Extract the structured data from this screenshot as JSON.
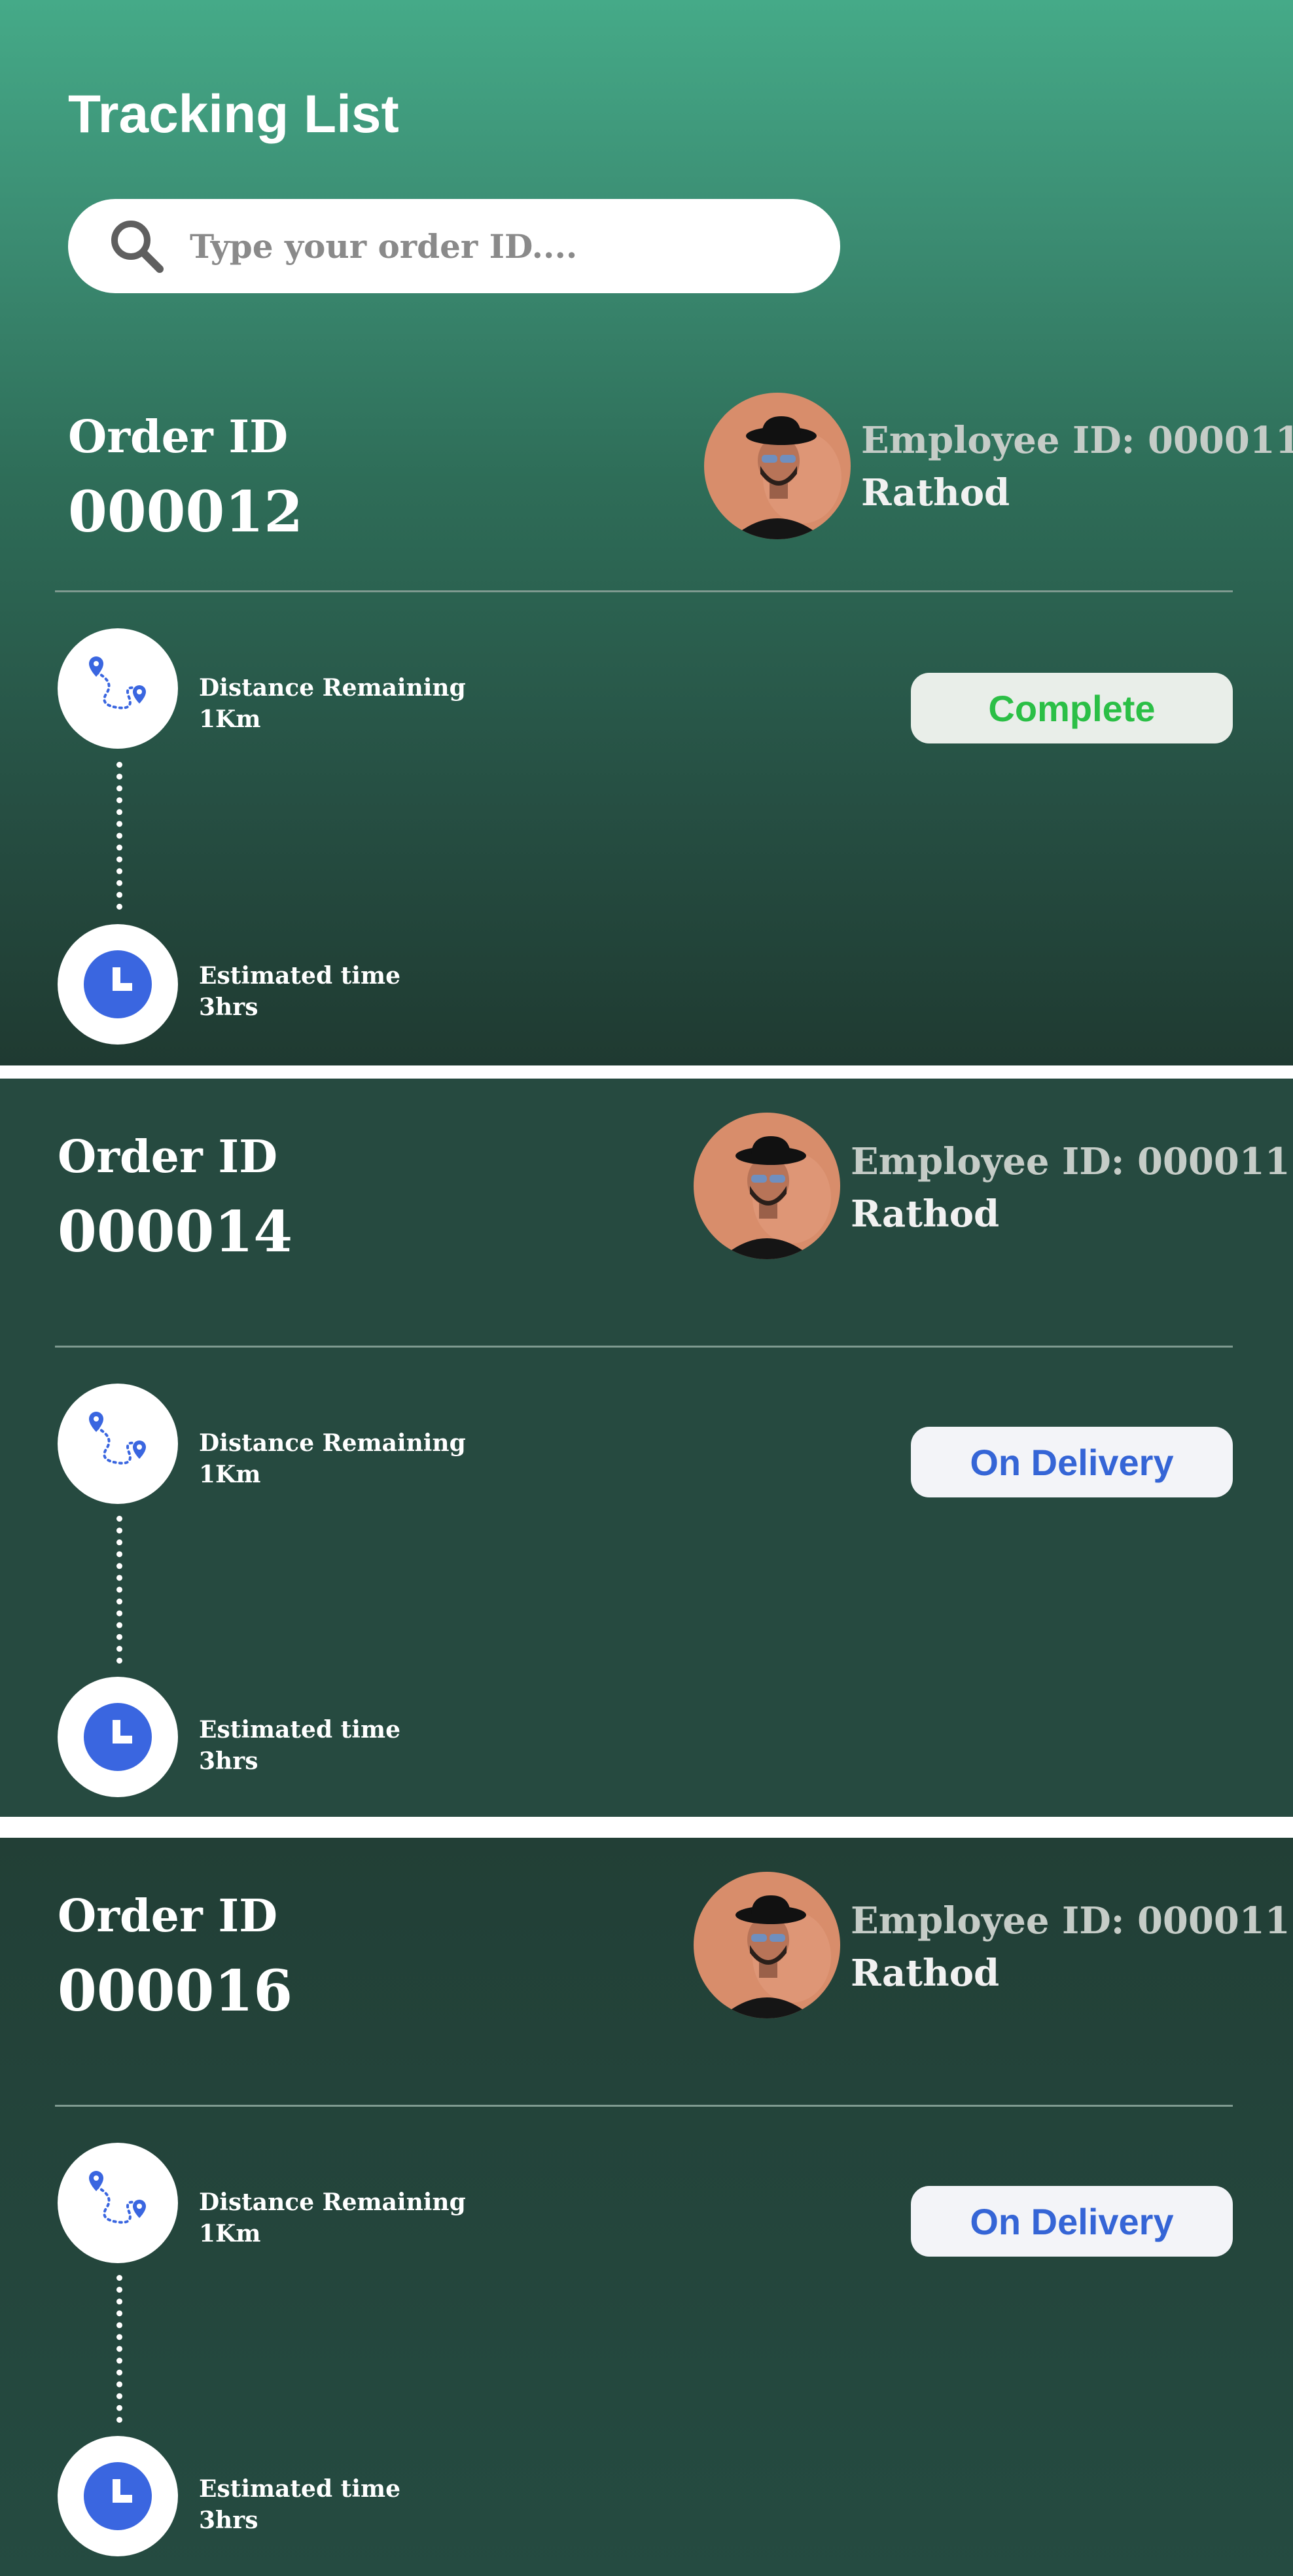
{
  "header": {
    "title": "Tracking List"
  },
  "search": {
    "placeholder": "Type your order ID...."
  },
  "orders": [
    {
      "label": "Order ID",
      "id": "000012",
      "employee_id": "Employee ID: 000011",
      "employee_name": "Rathod",
      "distance_label": "Distance Remaining",
      "distance_value": "1Km",
      "time_label": "Estimated time",
      "time_value": "3hrs",
      "status": "Complete",
      "status_color": "#2bbf46",
      "status_bg": "#e9eee9"
    },
    {
      "label": "Order ID",
      "id": "000014",
      "employee_id": "Employee ID: 000011",
      "employee_name": "Rathod",
      "distance_label": "Distance Remaining",
      "distance_value": "1Km",
      "time_label": "Estimated time",
      "time_value": "3hrs",
      "status": "On Delivery",
      "status_color": "#3565d6",
      "status_bg": "#f3f4f8"
    },
    {
      "label": "Order ID",
      "id": "000016",
      "employee_id": "Employee ID: 000011",
      "employee_name": "Rathod",
      "distance_label": "Distance Remaining",
      "distance_value": "1Km",
      "time_label": "Estimated time",
      "time_value": "3hrs",
      "status": "On Delivery",
      "status_color": "#3565d6",
      "status_bg": "#f3f4f8"
    }
  ],
  "icons": {
    "search": "search-icon",
    "route": "route-map-icon",
    "clock": "clock-icon",
    "avatar": "employee-avatar"
  },
  "colors": {
    "accent_blue": "#3a66e0",
    "complete_green": "#2bbf46"
  }
}
